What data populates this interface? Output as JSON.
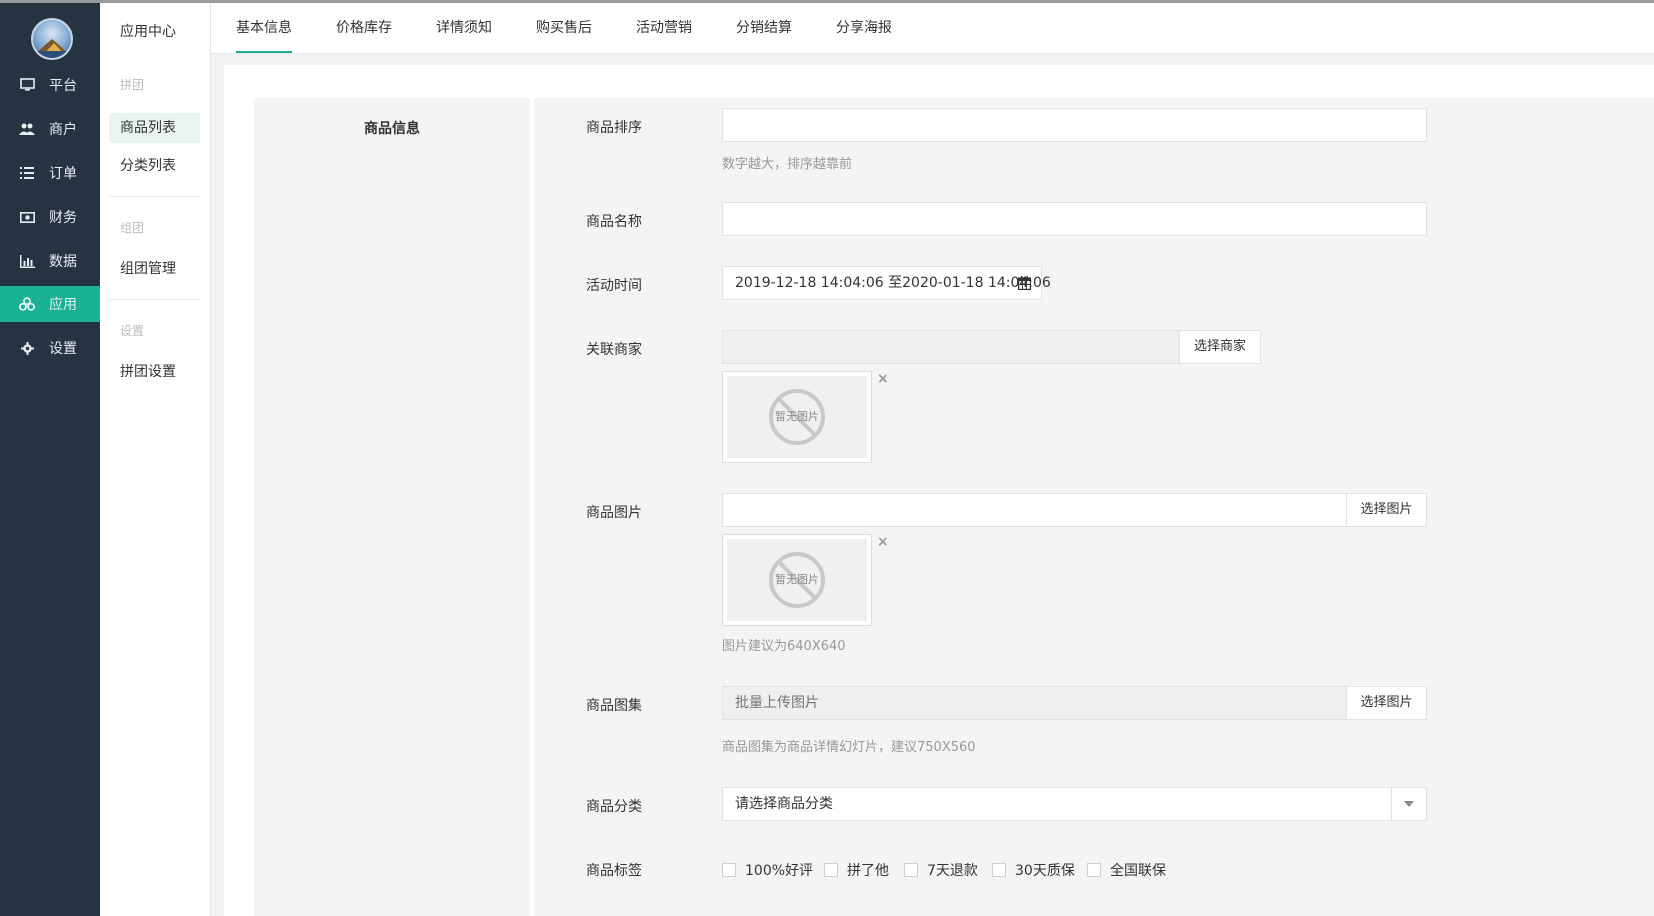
{
  "sidebar": {
    "items": [
      {
        "label": "平台",
        "icon": "monitor-icon"
      },
      {
        "label": "商户",
        "icon": "users-icon"
      },
      {
        "label": "订单",
        "icon": "list-icon"
      },
      {
        "label": "财务",
        "icon": "money-icon"
      },
      {
        "label": "数据",
        "icon": "bar-chart-icon"
      },
      {
        "label": "应用",
        "icon": "cubes-icon",
        "active": true
      },
      {
        "label": "设置",
        "icon": "gear-icon"
      }
    ],
    "accent": "#19b394",
    "background": "#263341"
  },
  "subnav": {
    "header": "应用中心",
    "groups": [
      {
        "title": "拼团",
        "items": [
          "商品列表",
          "分类列表"
        ]
      },
      {
        "title": "组团",
        "items": [
          "组团管理"
        ]
      },
      {
        "title": "设置",
        "items": [
          "拼团设置"
        ]
      }
    ],
    "active_item": "商品列表"
  },
  "tabs": [
    "基本信息",
    "价格库存",
    "详情须知",
    "购买售后",
    "活动营销",
    "分销结算",
    "分享海报"
  ],
  "active_tab": "基本信息",
  "form": {
    "section_title": "商品信息",
    "sort": {
      "label": "商品排序",
      "value": "",
      "help": "数字越大，排序越靠前"
    },
    "name": {
      "label": "商品名称",
      "value": ""
    },
    "time": {
      "label": "活动时间",
      "value": "2019-12-18 14:04:06 至2020-01-18 14:04:06"
    },
    "merchant": {
      "label": "关联商家",
      "button": "选择商家",
      "placeholder_image": "暂无图片"
    },
    "image": {
      "label": "商品图片",
      "button": "选择图片",
      "placeholder_image": "暂无图片",
      "help": "图片建议为640X640"
    },
    "gallery": {
      "label": "商品图集",
      "placeholder": "批量上传图片",
      "button": "选择图片",
      "help": "商品图集为商品详情幻灯片，建议750X560"
    },
    "category": {
      "label": "商品分类",
      "selected": "请选择商品分类"
    },
    "tags": {
      "label": "商品标签",
      "options": [
        "100%好评",
        "拼了他",
        "7天退款",
        "30天质保",
        "全国联保"
      ]
    }
  }
}
